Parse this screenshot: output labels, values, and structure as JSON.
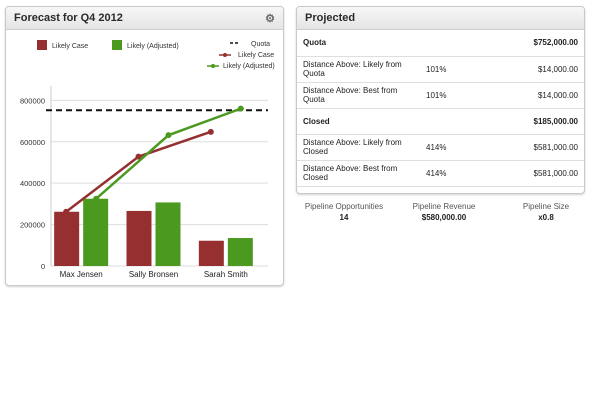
{
  "forecast": {
    "title": "Forecast for Q4 2012",
    "gear_icon": "gear-icon",
    "legend": {
      "likely_case": "Likely Case",
      "likely_adjusted": "Likely (Adjusted)",
      "quota": "Quota",
      "likely_case_line": "Likely Case",
      "likely_adjusted_line": "Likely (Adjusted)"
    },
    "colors": {
      "red": "#963030",
      "green": "#4b9a1f",
      "quota": "#111111"
    }
  },
  "chart_data": {
    "type": "bar",
    "categories": [
      "Max Jensen",
      "Sally Bronsen",
      "Sarah Smith"
    ],
    "series": [
      {
        "name": "Likely Case",
        "type": "bar",
        "values": [
          262000,
          266000,
          122000
        ]
      },
      {
        "name": "Likely (Adjusted)",
        "type": "bar",
        "values": [
          325000,
          307000,
          135000
        ]
      },
      {
        "name": "Likely Case",
        "type": "line",
        "values": [
          262000,
          528000,
          648000
        ]
      },
      {
        "name": "Likely (Adjusted)",
        "type": "line",
        "values": [
          325000,
          632000,
          760000
        ]
      },
      {
        "name": "Quota",
        "type": "line",
        "style": "dashed",
        "value": 752000
      }
    ],
    "yticks": [
      "0",
      "200000",
      "400000",
      "600000",
      "800000"
    ],
    "ylim": [
      0,
      850000
    ],
    "grid": true,
    "legend_position": "top"
  },
  "projected": {
    "title": "Projected",
    "rows": [
      {
        "label": "Quota",
        "pct": "",
        "value": "$752,000.00",
        "bold": true
      },
      {
        "label": "Distance Above: Likely from Quota",
        "pct": "101%",
        "value": "$14,000.00",
        "bold": false
      },
      {
        "label": "Distance Above: Best from Quota",
        "pct": "101%",
        "value": "$14,000.00",
        "bold": false
      },
      {
        "label": "Closed",
        "pct": "",
        "value": "$185,000.00",
        "bold": true
      },
      {
        "label": "Distance Above: Likely from Closed",
        "pct": "414%",
        "value": "$581,000.00",
        "bold": false
      },
      {
        "label": "Distance Above: Best from Closed",
        "pct": "414%",
        "value": "$581,000.00",
        "bold": false
      }
    ]
  },
  "pipeline": {
    "opportunities_label": "Pipeline Opportunities",
    "opportunities_value": "14",
    "revenue_label": "Pipeline Revenue",
    "revenue_value": "$580,000.00",
    "size_label": "Pipeline Size",
    "size_value": "x0.8"
  }
}
